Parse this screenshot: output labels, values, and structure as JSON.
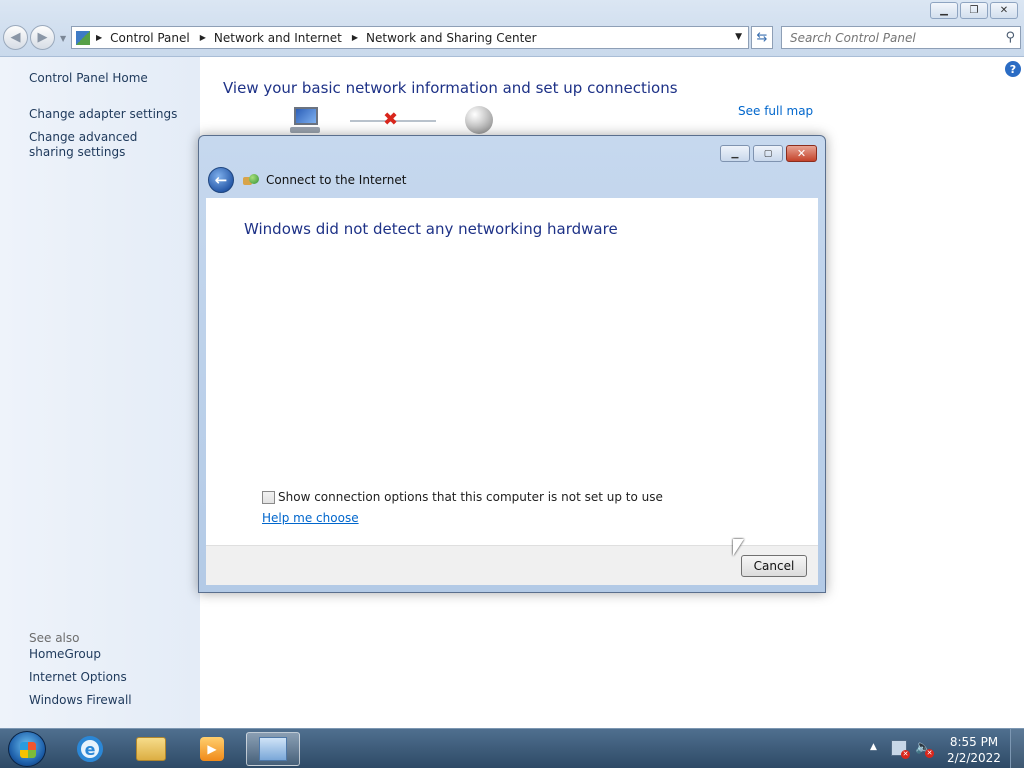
{
  "window": {
    "breadcrumb": [
      "Control Panel",
      "Network and Internet",
      "Network and Sharing Center"
    ],
    "search_placeholder": "Search Control Panel"
  },
  "sidebar": {
    "home": "Control Panel Home",
    "links": [
      "Change adapter settings",
      "Change advanced sharing settings"
    ],
    "see_also_label": "See also",
    "see_also": [
      "HomeGroup",
      "Internet Options",
      "Windows Firewall"
    ]
  },
  "main": {
    "title": "View your basic network information and set up connections",
    "full_map_link": "See full map"
  },
  "dialog": {
    "title": "Connect to the Internet",
    "heading": "Windows did not detect any networking hardware",
    "checkbox_label": "Show connection options that this computer is not set up to use",
    "checkbox_checked": false,
    "help_link": "Help me choose",
    "cancel_label": "Cancel"
  },
  "taskbar": {
    "time": "8:55 PM",
    "date": "2/2/2022",
    "pinned_icons": [
      "internet-explorer-icon",
      "windows-explorer-icon",
      "media-player-icon",
      "control-panel-icon"
    ]
  }
}
